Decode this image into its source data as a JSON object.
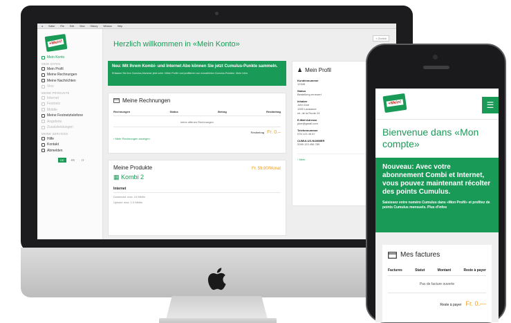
{
  "desktop": {
    "menubar_items": [
      "Safari",
      "File",
      "Edit",
      "View",
      "History",
      "Window",
      "Help"
    ],
    "logo_text": "+Mein!",
    "sidebar": {
      "items": [
        {
          "label": "Mein Konto",
          "state": "active"
        },
        {
          "label": "MEIN DATEN",
          "state": "header"
        },
        {
          "label": "Mein Profil",
          "state": "normal"
        },
        {
          "label": "Meine Rechnungen",
          "state": "normal"
        },
        {
          "label": "Meine Nachrichten",
          "state": "normal"
        },
        {
          "label": "Vivo",
          "state": "muted"
        },
        {
          "label": "MEINE PRODUKTE",
          "state": "header"
        },
        {
          "label": "Internet",
          "state": "muted"
        },
        {
          "label": "Festnetz",
          "state": "muted"
        },
        {
          "label": "Mobile",
          "state": "muted"
        },
        {
          "label": "Meine Festnetztelefone",
          "state": "normal"
        },
        {
          "label": "Angebote",
          "state": "muted"
        },
        {
          "label": "Zusatzleistungen",
          "state": "muted"
        },
        {
          "label": "MEINE SERVICES",
          "state": "header"
        },
        {
          "label": "Hilfe",
          "state": "normal"
        },
        {
          "label": "Kontakt",
          "state": "normal"
        },
        {
          "label": "Abmelden",
          "state": "normal"
        }
      ],
      "languages": [
        {
          "code": "DE",
          "on": true
        },
        {
          "code": "FR",
          "on": false
        },
        {
          "code": "IT",
          "on": false
        }
      ]
    },
    "top_button": "« Zurück",
    "title": "Herzlich willkommen in «Mein Konto»",
    "banner": {
      "headline": "Neu: Mit Ihrem Kombi- und Internet Abo können Sie jetzt Cumulus-Punkte sammeln.",
      "text": "Erfassen Sie Ihre Cumulus-Nummer jetzt unter «Mein Profil» und profitieren von monatlichen Cumulus-Punkten. Mehr Infos"
    },
    "invoices": {
      "title": "Meine Rechnungen",
      "columns": [
        "Rechnungen",
        "Status",
        "Betrag",
        "Restbetrag"
      ],
      "empty": "keine offenen Rechnungen",
      "total_label": "Restbetrag",
      "total_value": "Fr. 0.–",
      "more_link": "Mehr Rechnungen anzeigen"
    },
    "products": {
      "title": "Meine Produkte",
      "price": "Fr. 59.80/Monat",
      "product_name": "Kombi 2",
      "section": "Internet",
      "details": [
        "Download: max. 10 Mbit/s",
        "Upload: max. 1.0 Mbit/s"
      ]
    },
    "profile": {
      "title": "Mein Profil",
      "fields": [
        {
          "label": "Kundennummer",
          "values": [
            "12345"
          ]
        },
        {
          "label": "Status",
          "values": [
            "Bestellung erneuert"
          ]
        },
        {
          "label": "Inhaber",
          "values": [
            "John Doe",
            "1000 Lausanne",
            "ch. de la Route 24"
          ]
        },
        {
          "label": "E-Mail Adresse",
          "values": [
            "jdoe@gmail.com"
          ]
        },
        {
          "label": "Telefonnummer",
          "values": [
            "076 123 45 67"
          ]
        },
        {
          "label": "CUMULUS-NUMMER",
          "values": [
            "2099 123 456 789"
          ]
        }
      ],
      "more": "Mehr"
    }
  },
  "mobile": {
    "logo_text": "+Mein!",
    "menu_icon": "menu-icon",
    "title": "Bienvenue dans «Mon compte»",
    "banner": {
      "headline": "Nouveau: Avec votre abonnement Combi et Internet, vous pouvez maintenant récolter des points Cumulus.",
      "text": "Saisissez votre numéro Cumulus dans «Mon Profil» et profitez de points Cumulus mensuels. Plus d'infos"
    },
    "invoices": {
      "title": "Mes factures",
      "columns": [
        "Factures",
        "Statut",
        "Montant",
        "Reste à payer"
      ],
      "empty": "Pas de facture ouverte",
      "total_label": "Reste à payer",
      "total_value": "Fr. 0.—"
    }
  },
  "colors": {
    "brand_green": "#1a9a57",
    "accent_orange": "#f39c12"
  }
}
